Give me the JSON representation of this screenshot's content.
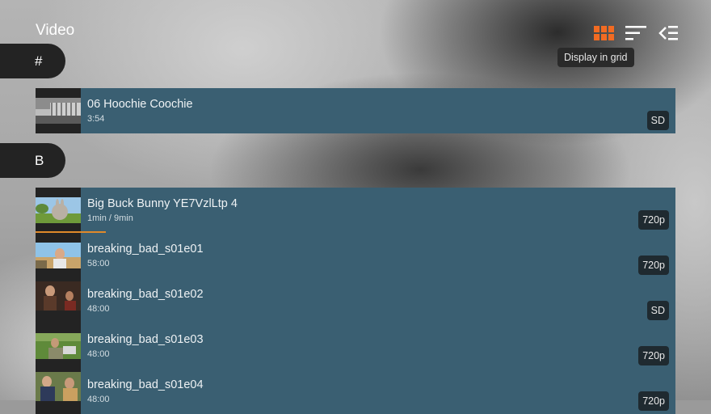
{
  "header": {
    "title": "Video",
    "tooltip": "Display in grid",
    "accent_color": "#f26b22",
    "icons": [
      "grid-view-icon",
      "sort-icon",
      "select-list-icon"
    ]
  },
  "sections": [
    {
      "letter": "#",
      "items": [
        {
          "title": "06 Hoochie Coochie",
          "subtitle": "3:54",
          "badge": "SD",
          "thumb": "bw-building"
        }
      ]
    },
    {
      "letter": "B",
      "items": [
        {
          "title": "Big Buck Bunny YE7VzlLtp 4",
          "subtitle": "1min / 9min",
          "badge": "720p",
          "progress": 0.11,
          "thumb": "meadow"
        },
        {
          "title": "breaking_bad_s01e01",
          "subtitle": "58:00",
          "badge": "720p",
          "thumb": "desert"
        },
        {
          "title": "breaking_bad_s01e02",
          "subtitle": "48:00",
          "badge": "SD",
          "thumb": "dark-room"
        },
        {
          "title": "breaking_bad_s01e03",
          "subtitle": "48:00",
          "badge": "720p",
          "thumb": "green-room"
        },
        {
          "title": "breaking_bad_s01e04",
          "subtitle": "48:00",
          "badge": "720p",
          "thumb": "kitchen"
        }
      ]
    }
  ]
}
